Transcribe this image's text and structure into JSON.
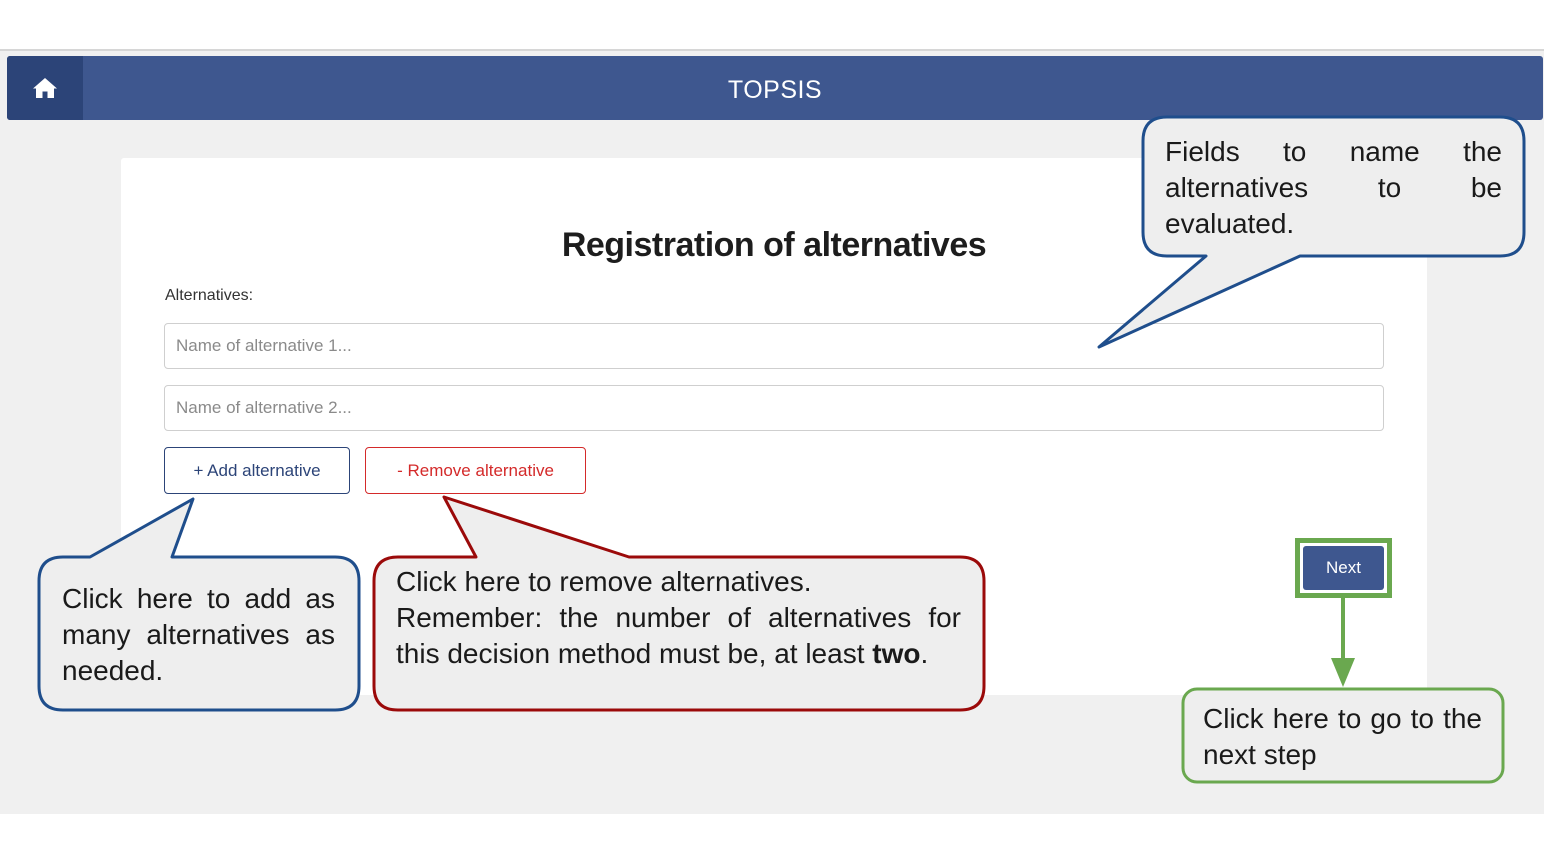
{
  "navbar": {
    "title": "TOPSIS",
    "home_icon": "home-icon"
  },
  "page": {
    "title": "Registration of alternatives",
    "alternatives_label": "Alternatives:",
    "alternative_inputs": [
      {
        "placeholder": "Name of alternative 1...",
        "value": ""
      },
      {
        "placeholder": "Name of alternative 2...",
        "value": ""
      }
    ],
    "add_button": "+ Add alternative",
    "remove_button": "- Remove alternative",
    "next_button": "Next"
  },
  "callouts": {
    "fields": "Fields to name the alternatives to be evaluated.",
    "add": "Click here to add as many alternatives as needed.",
    "remove_line1": "Click here to remove alternatives.",
    "remove_line2": "Remember: the number of alternatives for this decision method must be, at least",
    "remove_bold": "two",
    "remove_end": ".",
    "next": "Click here to go to the next step"
  },
  "colors": {
    "navbar": "#3e578f",
    "home": "#2c4478",
    "callout_blue": "#1f4e8c",
    "callout_red": "#9b0a0a",
    "callout_green": "#6aa84f",
    "callout_fill": "#eeeeee"
  }
}
